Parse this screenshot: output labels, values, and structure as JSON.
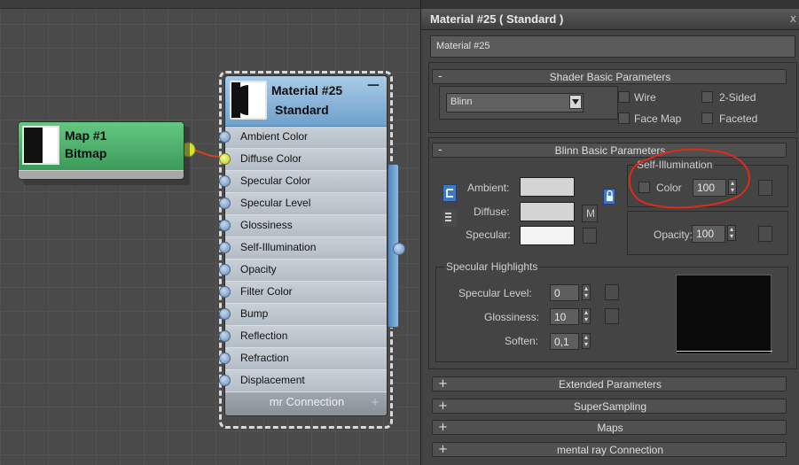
{
  "map_node": {
    "title": "Map #1",
    "subtitle": "Bitmap"
  },
  "material_node": {
    "title": "Material #25",
    "subtitle": "Standard",
    "collapse": "—",
    "slots": [
      "Ambient Color",
      "Diffuse Color",
      "Specular Color",
      "Specular Level",
      "Glossiness",
      "Self-Illumination",
      "Opacity",
      "Filter Color",
      "Bump",
      "Reflection",
      "Refraction",
      "Displacement"
    ],
    "connected_slot": "Diffuse Color",
    "mr_connection": "mr Connection",
    "mr_plus": "+"
  },
  "panel": {
    "title": "Material #25  ( Standard )",
    "close": "x",
    "name_value": "Material #25",
    "shader_rollout": {
      "sym": "-",
      "title": "Shader Basic Parameters",
      "shader": "Blinn",
      "wire": "Wire",
      "two_sided": "2-Sided",
      "face_map": "Face Map",
      "faceted": "Faceted"
    },
    "blinn_rollout": {
      "sym": "-",
      "title": "Blinn Basic Parameters",
      "ambient": "Ambient:",
      "diffuse": "Diffuse:",
      "specular": "Specular:",
      "m_button": "M",
      "self_illum_title": "Self-Illumination",
      "color_label": "Color",
      "self_illum_value": "100",
      "opacity_label": "Opacity:",
      "opacity_value": "100",
      "spec_highlights_title": "Specular Highlights",
      "spec_level_label": "Specular Level:",
      "spec_level_value": "0",
      "gloss_label": "Glossiness:",
      "gloss_value": "10",
      "soften_label": "Soften:",
      "soften_value": "0,1"
    },
    "collapsed_rollouts": [
      {
        "sym": "+",
        "title": "Extended Parameters"
      },
      {
        "sym": "+",
        "title": "SuperSampling"
      },
      {
        "sym": "+",
        "title": "Maps"
      },
      {
        "sym": "+",
        "title": "mental ray Connection"
      }
    ]
  },
  "colors": {
    "map_node_green": "#4faf6e",
    "material_header_blue": "#8ab6dc",
    "annotation_red": "#e02a1a",
    "ambient_swatch": "#d4d4d4",
    "diffuse_swatch": "#d4d4d4",
    "specular_swatch": "#f4f4f4",
    "highlight_preview": "#0b0b0b"
  },
  "icons": {
    "material_preview": "half-black-sphere-icon",
    "map_preview": "half-black-square-icon",
    "dropdown": "dropdown-arrow-icon",
    "spinner": "spinner-arrows-icon",
    "lock": "lock-icon"
  }
}
